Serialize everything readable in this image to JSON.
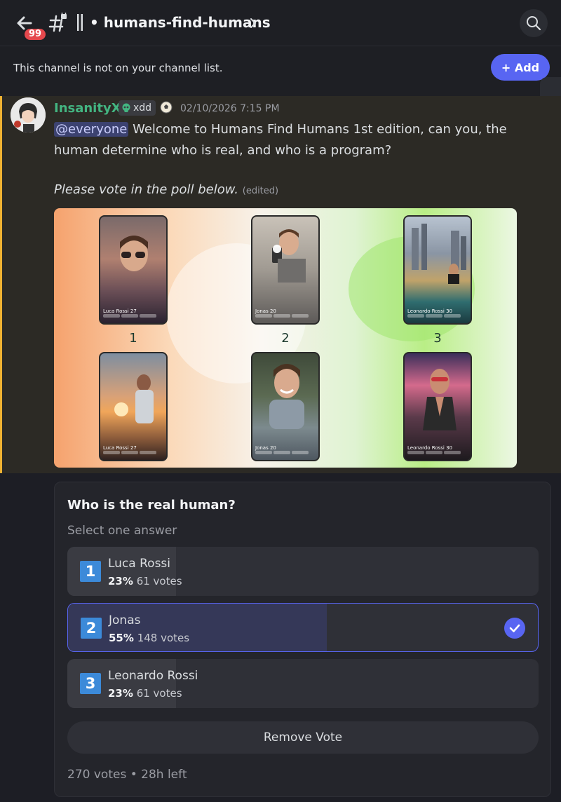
{
  "header": {
    "unread_badge": "99",
    "channel_name": "humans-find-humans"
  },
  "notice": {
    "text": "This channel is not on your channel list.",
    "add_label": "+ Add"
  },
  "message": {
    "author": "InsanityX",
    "tag": "xdd",
    "timestamp": "02/10/2026 7:15 PM",
    "mention": "@everyone",
    "text": " Welcome to Humans Find Humans 1st edition, can you, the human determine who is real, and who is a program?",
    "line2": "Please vote in the poll below.",
    "edited": "(edited)"
  },
  "image": {
    "numbers": [
      "1",
      "2",
      "3"
    ],
    "cards": [
      {
        "name": "Luca Rossi 27"
      },
      {
        "name": "Jonas 20"
      },
      {
        "name": "Leonardo Rossi 30"
      },
      {
        "name": "Luca Rossi 27"
      },
      {
        "name": "Jonas 20"
      },
      {
        "name": "Leonardo Rossi 30"
      }
    ]
  },
  "poll": {
    "question": "Who is the real human?",
    "hint": "Select one answer",
    "options": [
      {
        "num": "1",
        "name": "Luca Rossi",
        "percent": "23%",
        "votes": "61 votes",
        "fraction": 0.23
      },
      {
        "num": "2",
        "name": "Jonas",
        "percent": "55%",
        "votes": "148 votes",
        "fraction": 0.55
      },
      {
        "num": "3",
        "name": "Leonardo Rossi",
        "percent": "23%",
        "votes": "61 votes",
        "fraction": 0.23
      }
    ],
    "remove_label": "Remove Vote",
    "total_votes": "270 votes",
    "separator": "•",
    "time_left": "28h left"
  },
  "colors": {
    "accent": "#5865f2",
    "author": "#43b581",
    "highlight_bar": "#f0b232"
  }
}
